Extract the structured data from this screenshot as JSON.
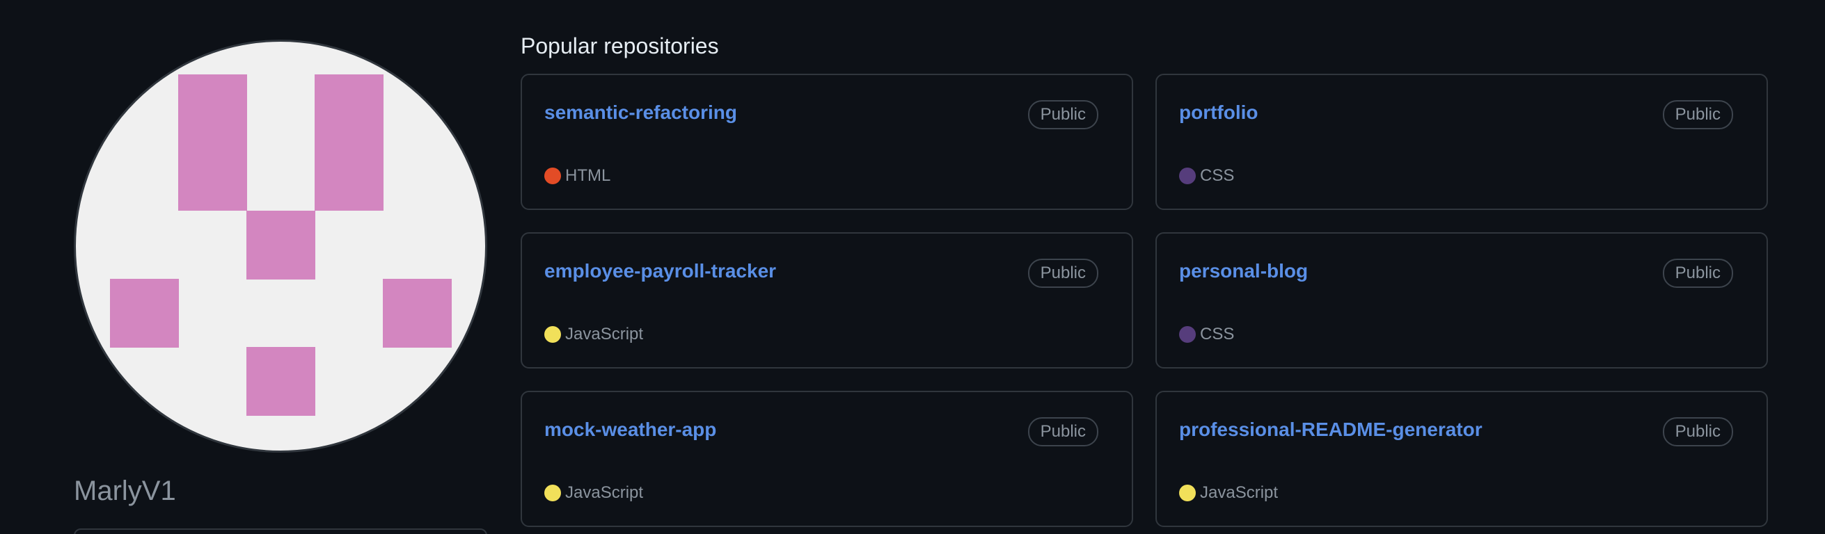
{
  "profile": {
    "username": "MarlyV1",
    "avatar_color": "#d386c0",
    "avatar_bg": "#f0f0f0"
  },
  "section_title": "Popular repositories",
  "repos": [
    {
      "name": "semantic-refactoring",
      "visibility": "Public",
      "language": "HTML",
      "language_color": "#e34c26"
    },
    {
      "name": "portfolio",
      "visibility": "Public",
      "language": "CSS",
      "language_color": "#563d7c"
    },
    {
      "name": "employee-payroll-tracker",
      "visibility": "Public",
      "language": "JavaScript",
      "language_color": "#f1e05a"
    },
    {
      "name": "personal-blog",
      "visibility": "Public",
      "language": "CSS",
      "language_color": "#563d7c"
    },
    {
      "name": "mock-weather-app",
      "visibility": "Public",
      "language": "JavaScript",
      "language_color": "#f1e05a"
    },
    {
      "name": "professional-README-generator",
      "visibility": "Public",
      "language": "JavaScript",
      "language_color": "#f1e05a"
    }
  ]
}
